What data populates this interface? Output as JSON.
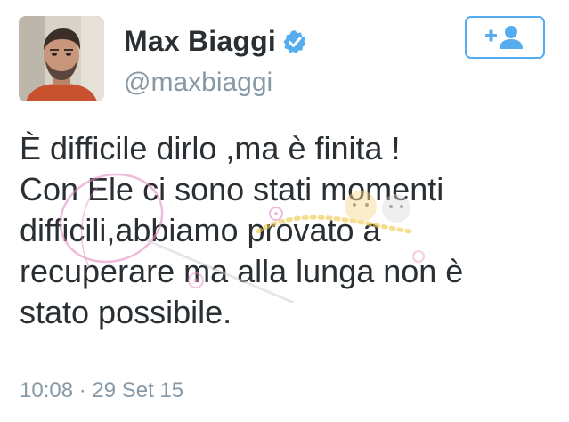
{
  "user": {
    "display_name": "Max Biaggi",
    "handle": "@maxbiaggi",
    "verified": true
  },
  "follow_button": {
    "icon": "add-user-icon"
  },
  "tweet": {
    "lines": [
      "È difficile dirlo ,ma è finita !",
      "Con Ele ci sono stati  momenti",
      "difficili,abbiamo provato a",
      "recuperare ma alla lunga non è",
      "stato possibile."
    ],
    "timestamp": "10:08 · 29 Set 15"
  },
  "colors": {
    "name": "#292f33",
    "secondary": "#8899a6",
    "accent": "#55acee",
    "watermark_pink": "#e48ec2"
  }
}
